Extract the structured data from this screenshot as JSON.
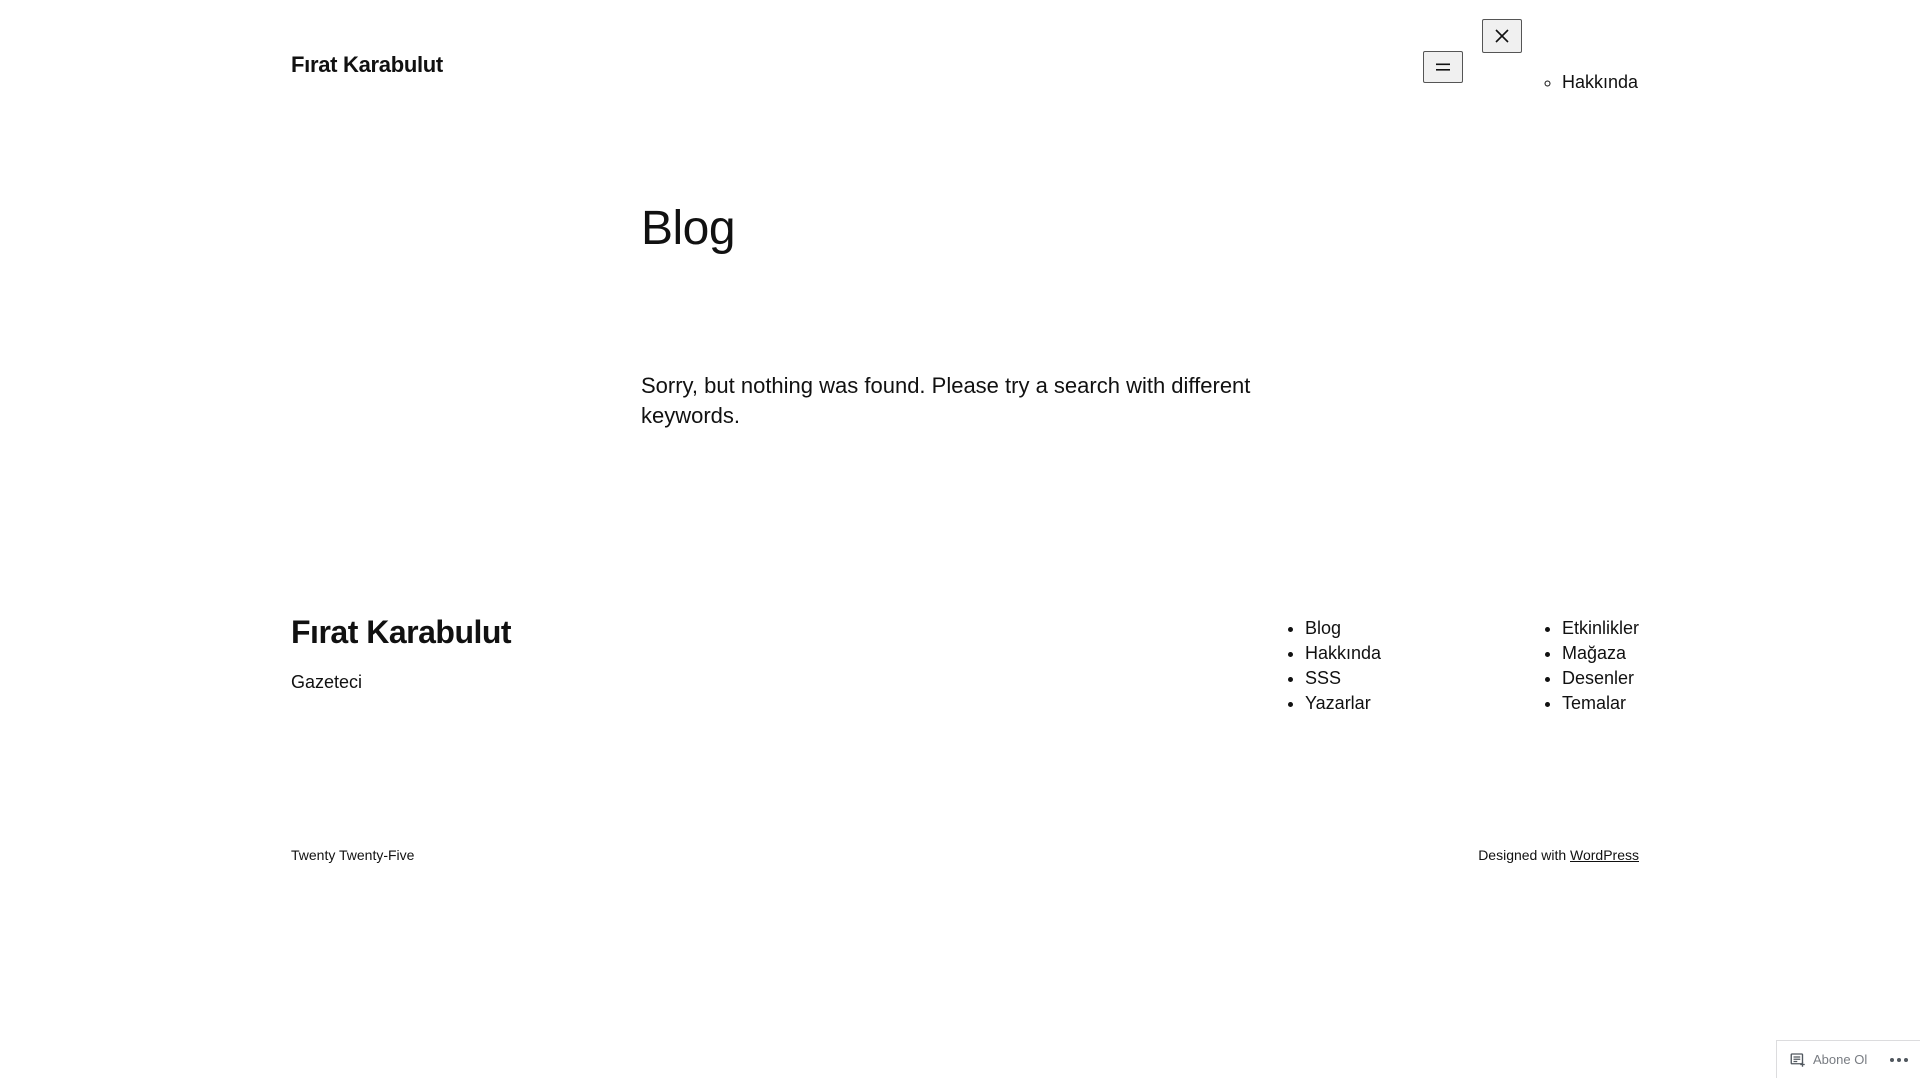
{
  "header": {
    "site_title": "Fırat Karabulut"
  },
  "overlay_menu": {
    "items": [
      "Hakkında"
    ]
  },
  "main": {
    "page_title": "Blog",
    "no_results": "Sorry, but nothing was found. Please try a search with different keywords."
  },
  "footer": {
    "site_title": "Fırat Karabulut",
    "tagline": "Gazeteci",
    "nav_1": [
      "Blog",
      "Hakkında",
      "SSS",
      "Yazarlar"
    ],
    "nav_2": [
      "Etkinlikler",
      "Mağaza",
      "Desenler",
      "Temalar"
    ],
    "theme_credit": "Twenty Twenty-Five",
    "designed_with": "Designed with",
    "wordpress_link": "WordPress"
  },
  "subscribe_bar": {
    "label": "Abone Ol"
  },
  "icons": {
    "menu": "hamburger-icon",
    "close": "close-icon",
    "subscribe": "reader-icon",
    "more": "ellipsis-icon"
  }
}
